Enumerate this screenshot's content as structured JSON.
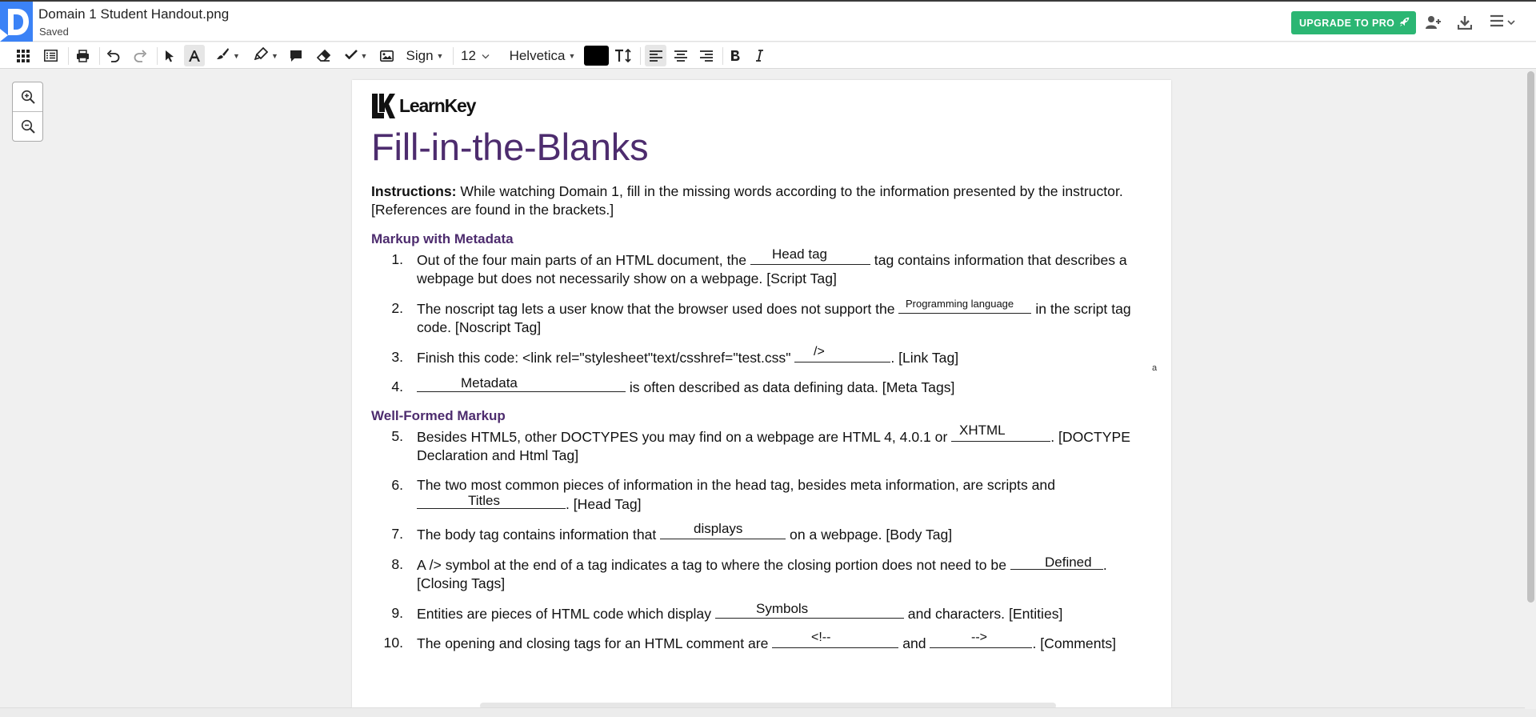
{
  "header": {
    "file_name": "Domain 1 Student Handout.png",
    "save_status": "Saved",
    "upgrade_label": "UPGRADE TO PRO",
    "icons": [
      "app-logo",
      "rocket-icon",
      "add-user-icon",
      "download-icon",
      "menu-icon",
      "chevron-down-icon"
    ],
    "brand_color": "#3b82f6",
    "upgrade_color": "#2bb673"
  },
  "toolbar": {
    "sign_label": "Sign",
    "font_size": "12",
    "font_family": "Helvetica",
    "text_color": "#000000",
    "icons": [
      "grid-icon",
      "list-icon",
      "print-icon",
      "undo-icon",
      "redo-icon",
      "pointer-icon",
      "text-icon",
      "brush-icon",
      "highlighter-icon",
      "comment-icon",
      "eraser-icon",
      "check-icon",
      "image-icon",
      "line-height-icon",
      "align-left-icon",
      "align-center-icon",
      "align-right-icon",
      "bold-icon",
      "italic-icon"
    ]
  },
  "zoom": {
    "icons": [
      "zoom-in-icon",
      "zoom-out-icon"
    ]
  },
  "document": {
    "brand": "LearnKey",
    "title": "Fill-in-the-Blanks",
    "instructions_label": "Instructions:",
    "instructions_text": " While watching Domain 1, fill in the missing words according to the information presented by the instructor. [References are found in the brackets.]",
    "stray_mark": "a",
    "sections": [
      {
        "heading": "Markup with Metadata"
      },
      {
        "heading": "Well-Formed Markup"
      }
    ],
    "items": [
      {
        "num": "1.",
        "before": "Out of the four main parts of an HTML document, the ",
        "after": " tag contains information that describes a webpage but does not necessarily show on a webpage. [Script Tag]",
        "answer": "Head tag"
      },
      {
        "num": "2.",
        "before": "The noscript tag lets a user know that the browser used does not support the ",
        "after": " in the script tag code. [Noscript Tag]",
        "answer": "Programming language"
      },
      {
        "num": "3.",
        "before": "Finish this code: <link rel=\"stylesheet\"text/csshref=\"test.css\" ",
        "after": ". [Link Tag]",
        "answer": "/>"
      },
      {
        "num": "4.",
        "before": "",
        "after": " is often described as data defining data. [Meta Tags]",
        "answer": "Metadata"
      },
      {
        "num": "5.",
        "before": "Besides HTML5, other DOCTYPES you may find on a webpage are HTML 4, 4.0.1 or ",
        "after": ". [DOCTYPE Declaration and Html Tag]",
        "answer": "XHTML"
      },
      {
        "num": "6.",
        "before": "The two most common pieces of information in the head tag, besides meta information, are scripts and ",
        "after": ". [Head Tag]",
        "answer": "Titles"
      },
      {
        "num": "7.",
        "before": "The body tag contains information that ",
        "after": " on a webpage. [Body Tag]",
        "answer": "displays"
      },
      {
        "num": "8.",
        "before": "A /> symbol at the end of a tag indicates a tag to where the closing portion does not need to be ",
        "after": ". [Closing Tags]",
        "answer": "Defined"
      },
      {
        "num": "9.",
        "before": "Entities are pieces of HTML code which display ",
        "after": " and characters. [Entities]",
        "answer": "Symbols"
      },
      {
        "num": "10.",
        "before": "The opening and closing tags for an HTML comment are ",
        "middle": " and ",
        "after": ". [Comments]",
        "answer": "<!--",
        "answer2": "-->"
      }
    ]
  }
}
